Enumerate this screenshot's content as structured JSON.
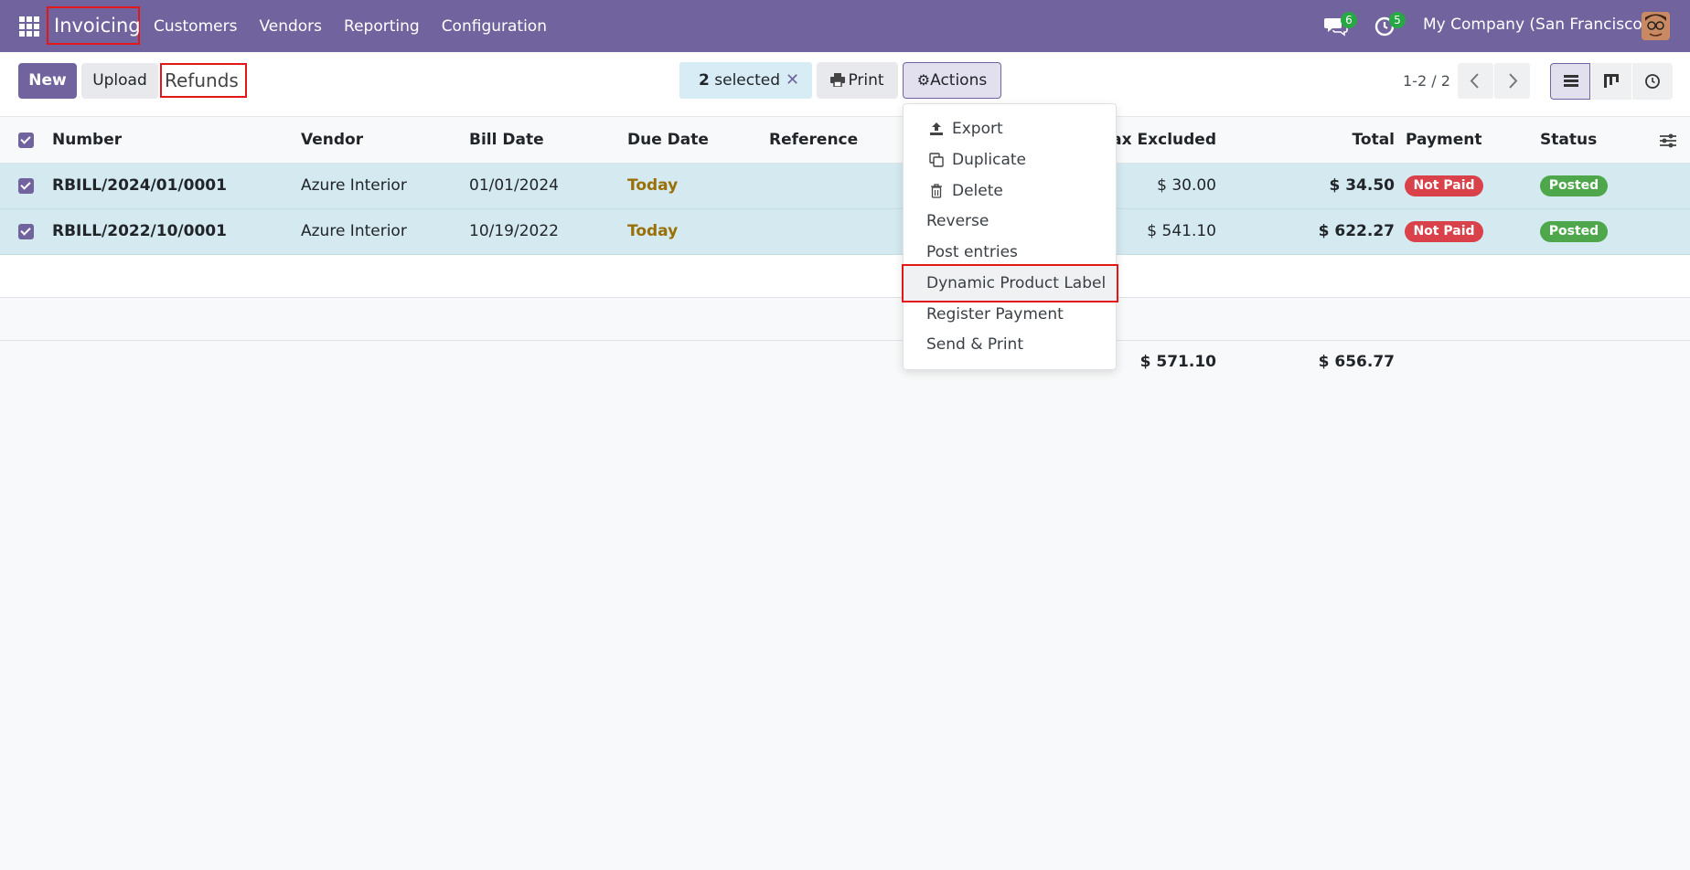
{
  "navbar": {
    "app_name": "Invoicing",
    "menu": [
      "Customers",
      "Vendors",
      "Reporting",
      "Configuration"
    ],
    "messages_count": "6",
    "activities_count": "5",
    "company": "My Company (San Francisco)",
    "color": "#71639e"
  },
  "control_panel": {
    "new_label": "New",
    "upload_label": "Upload",
    "breadcrumb": "Refunds",
    "selected_count": "2",
    "selected_label": "selected",
    "print_label": "Print",
    "actions_label": "Actions",
    "pager": "1-2 / 2"
  },
  "table": {
    "columns": {
      "number": "Number",
      "vendor": "Vendor",
      "bill_date": "Bill Date",
      "due_date": "Due Date",
      "reference": "Reference",
      "tax_excluded": "Tax Excluded",
      "total": "Total",
      "payment": "Payment",
      "status": "Status"
    },
    "rows": [
      {
        "number": "RBILL/2024/01/0001",
        "vendor": "Azure Interior",
        "bill_date": "01/01/2024",
        "due_date": "Today",
        "tax_excluded": "$ 30.00",
        "total": "$ 34.50",
        "payment": "Not Paid",
        "status": "Posted"
      },
      {
        "number": "RBILL/2022/10/0001",
        "vendor": "Azure Interior",
        "bill_date": "10/19/2022",
        "due_date": "Today",
        "tax_excluded": "$ 541.10",
        "total": "$ 622.27",
        "payment": "Not Paid",
        "status": "Posted"
      }
    ],
    "totals": {
      "tax_excluded": "$ 571.10",
      "total": "$ 656.77"
    }
  },
  "actions_menu": {
    "items": [
      {
        "label": "Export",
        "icon": "upload-icon"
      },
      {
        "label": "Duplicate",
        "icon": "copy-icon"
      },
      {
        "label": "Delete",
        "icon": "trash-icon"
      },
      {
        "label": "Reverse"
      },
      {
        "label": "Post entries"
      },
      {
        "label": "Dynamic Product Label"
      },
      {
        "label": "Register Payment"
      },
      {
        "label": "Send & Print"
      }
    ]
  }
}
